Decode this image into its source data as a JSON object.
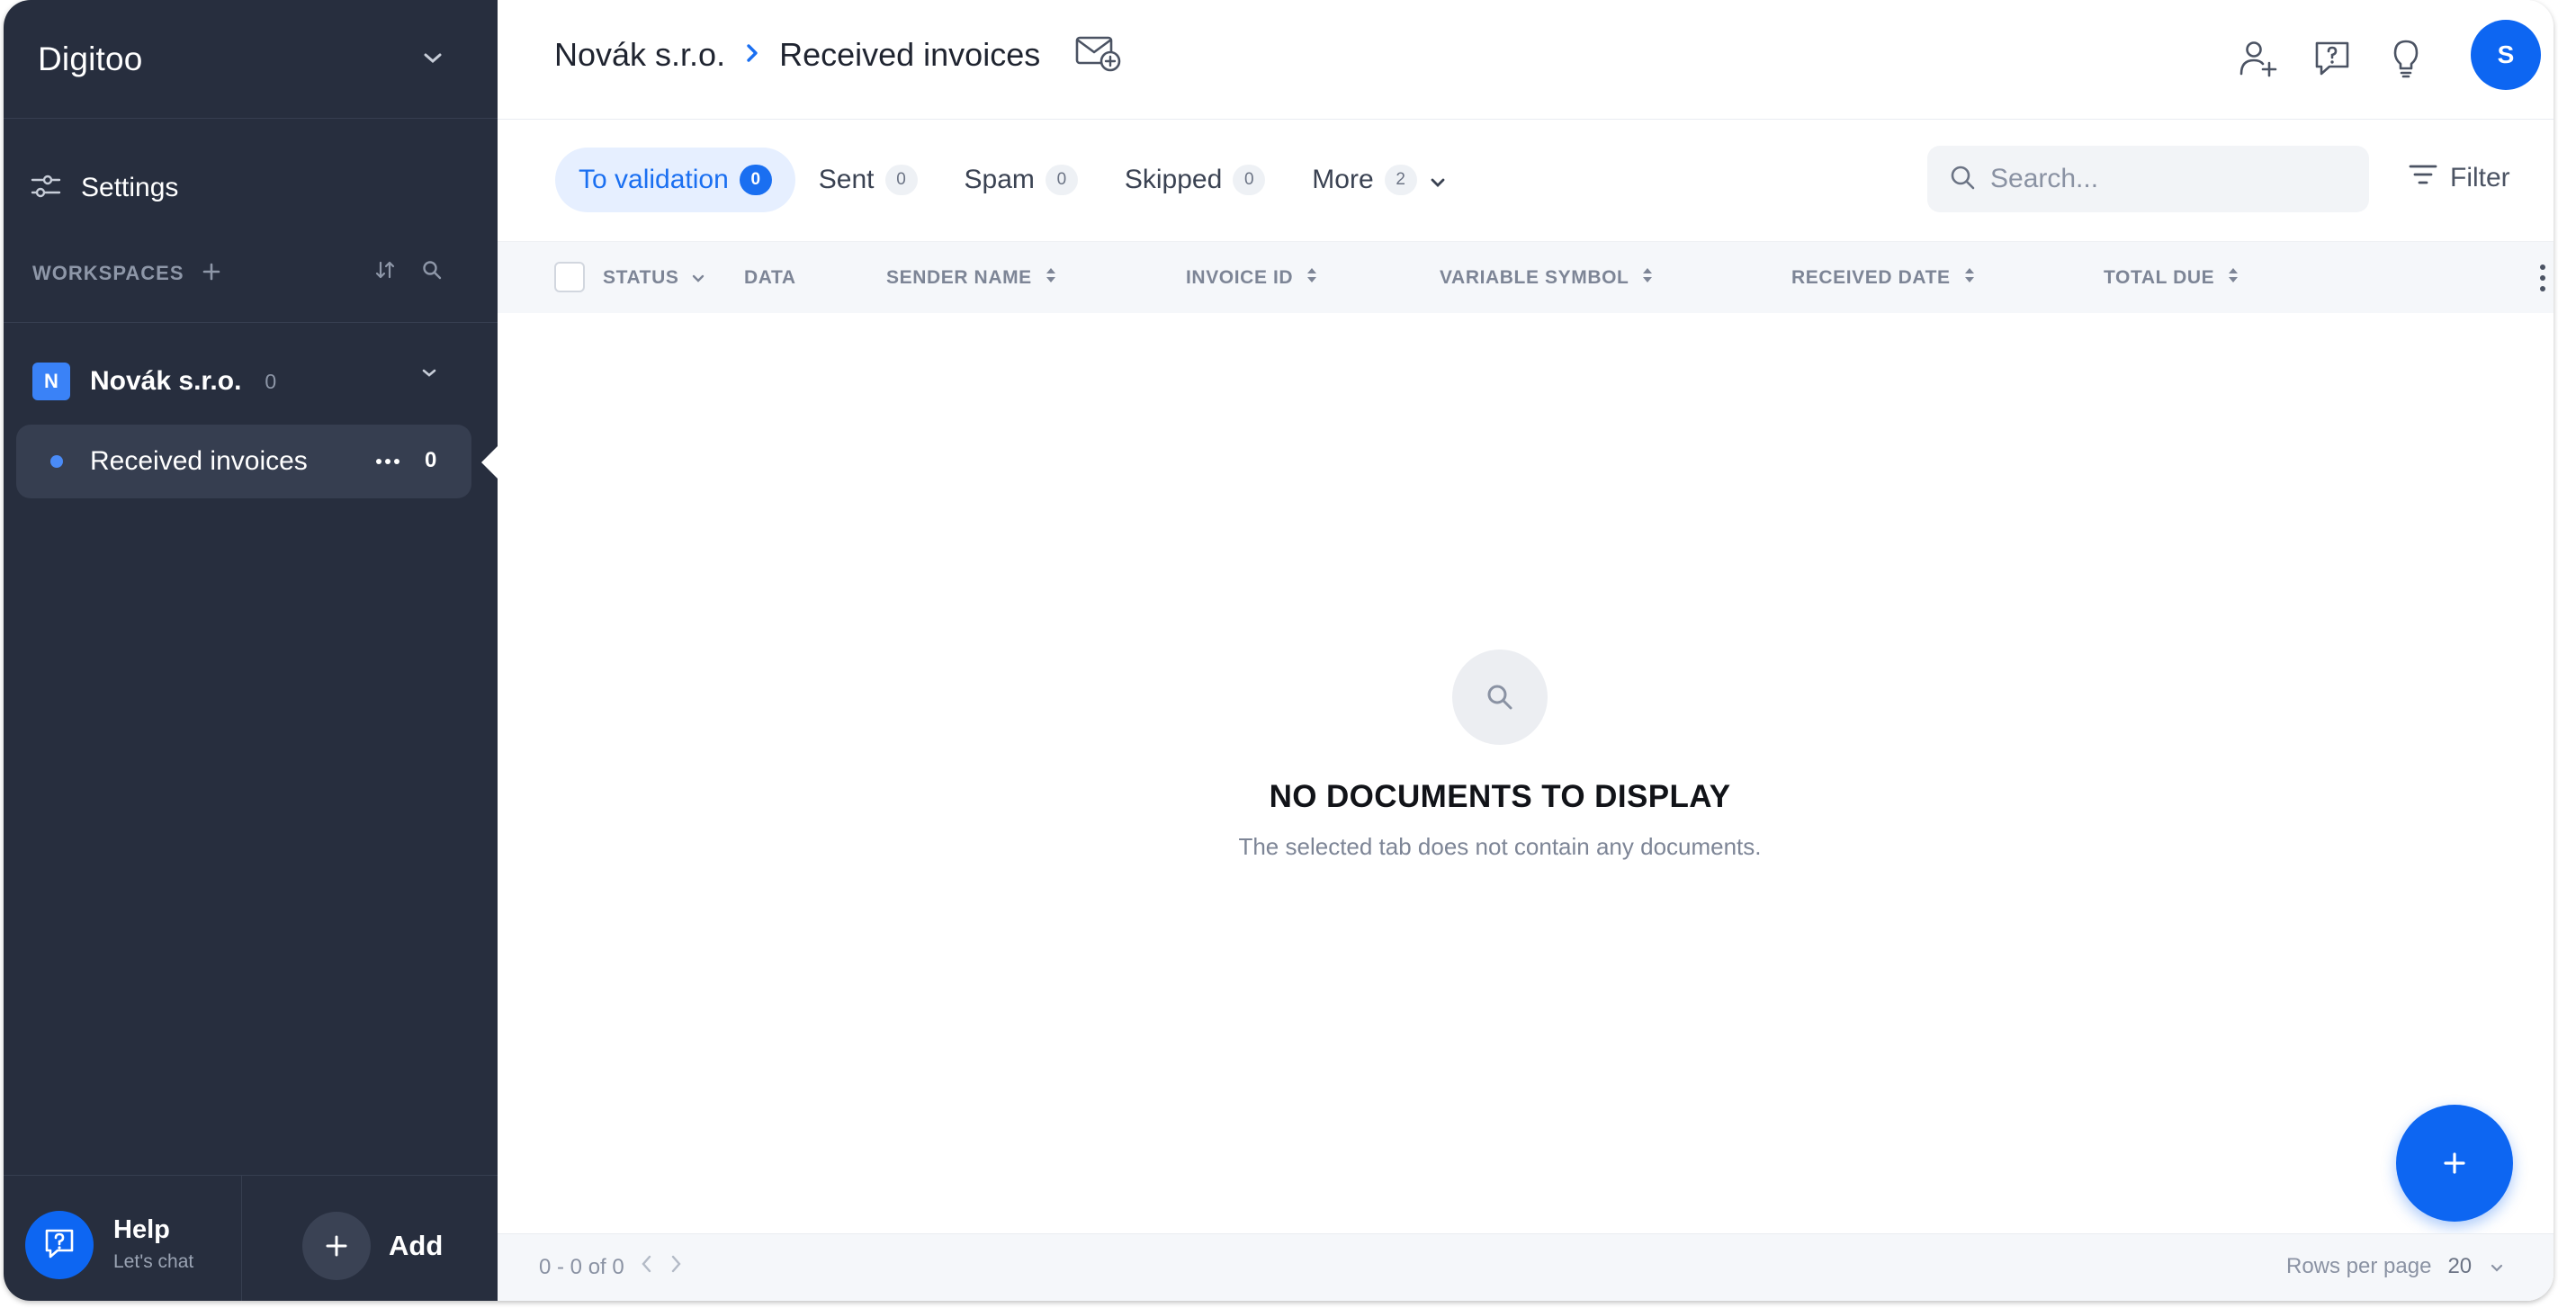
{
  "sidebar": {
    "brand": "Digitoo",
    "settings_label": "Settings",
    "workspaces_label": "WORKSPACES",
    "company": {
      "initial": "N",
      "name": "Novák s.r.o.",
      "count": "0"
    },
    "folder": {
      "label": "Received invoices",
      "count": "0"
    },
    "help": {
      "title": "Help",
      "subtitle": "Let's chat"
    },
    "add_label": "Add"
  },
  "header": {
    "breadcrumb_company": "Novák s.r.o.",
    "breadcrumb_page": "Received invoices",
    "avatar_initial": "S",
    "icons": [
      "add-user-icon",
      "help-chat-icon",
      "lightbulb-icon"
    ]
  },
  "tabs": [
    {
      "label": "To validation",
      "count": "0",
      "active": true
    },
    {
      "label": "Sent",
      "count": "0"
    },
    {
      "label": "Spam",
      "count": "0"
    },
    {
      "label": "Skipped",
      "count": "0"
    },
    {
      "label": "More",
      "count": "2"
    }
  ],
  "search": {
    "placeholder": "Search..."
  },
  "filter_label": "Filter",
  "table": {
    "columns": [
      "STATUS",
      "DATA",
      "SENDER NAME",
      "INVOICE ID",
      "VARIABLE SYMBOL",
      "RECEIVED DATE",
      "TOTAL DUE"
    ]
  },
  "empty_state": {
    "title": "NO DOCUMENTS TO DISPLAY",
    "subtitle": "The selected tab does not contain any documents."
  },
  "footer": {
    "range": "0 - 0 of 0",
    "rows_per_page_label": "Rows per page",
    "rows_per_page_value": "20"
  },
  "colors": {
    "sidebar_bg": "#272e3e",
    "accent": "#0d66f2",
    "active_tab_bg": "#e6efff"
  }
}
